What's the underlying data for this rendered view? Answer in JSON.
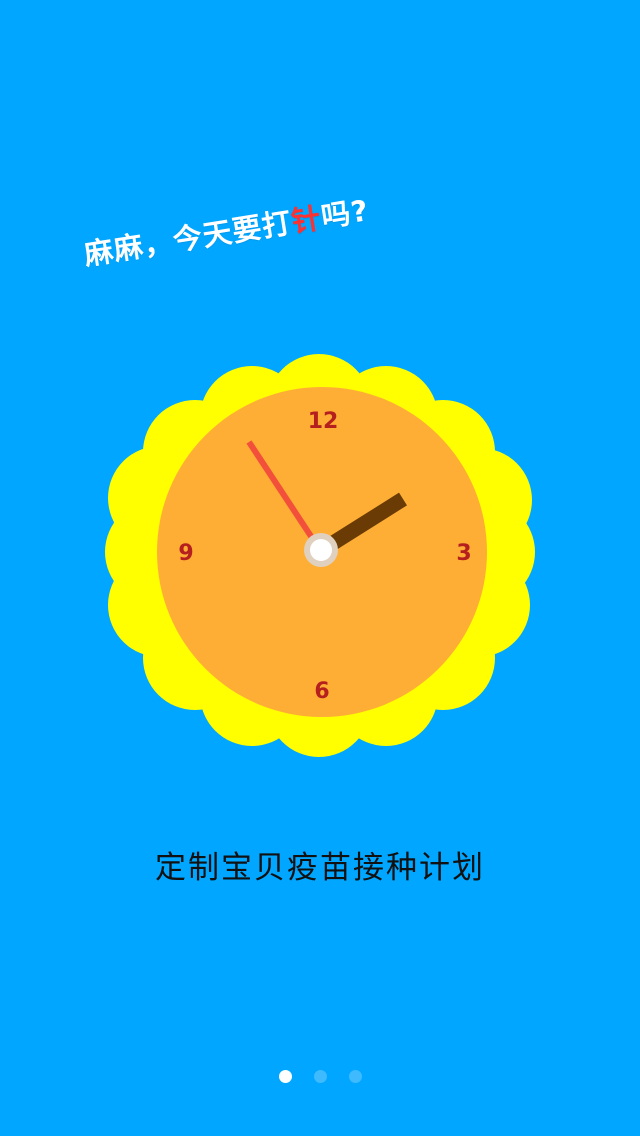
{
  "headline": {
    "prefix": "麻麻，今天要打",
    "accent": "针",
    "suffix": "吗?"
  },
  "clock": {
    "numerals": {
      "twelve": "12",
      "three": "3",
      "six": "6",
      "nine": "9"
    },
    "colors": {
      "petals": "#ffff00",
      "face": "#ffae35",
      "minute_hand": "#f2503b",
      "hour_hand": "#6b3b05",
      "hub": "#ffffff"
    }
  },
  "caption": "定制宝贝疫苗接种计划",
  "pager": {
    "count": 3,
    "active_index": 0
  },
  "colors": {
    "background": "#00a6ff",
    "headline_text": "#ffffff",
    "headline_accent": "#ff3030",
    "caption_text": "#111111"
  }
}
